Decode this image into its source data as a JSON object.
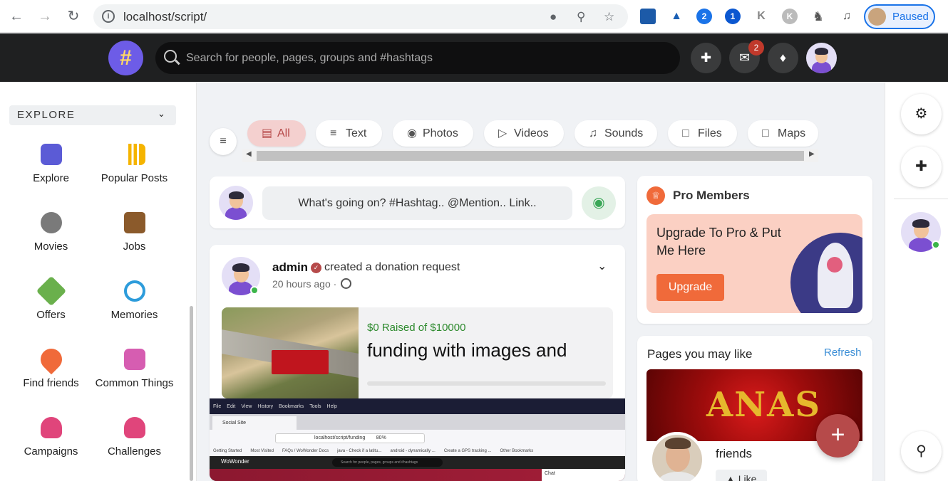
{
  "browser": {
    "url": "localhost/script/",
    "profile_status": "Paused",
    "extensions": [
      "map-ext-icon",
      "drive-ext-icon",
      "2-badge-icon",
      "1-badge-icon",
      "k-icon",
      "k-grey-icon",
      "puzzle-icon",
      "media-icon"
    ]
  },
  "header": {
    "logo": "#",
    "search_placeholder": "Search for people, pages, groups and #hashtags",
    "messages_badge": "2"
  },
  "sidebar": {
    "section": "EXPLORE",
    "items": [
      {
        "label": "Explore",
        "color": "#5b5bd6"
      },
      {
        "label": "Popular Posts",
        "color": "#f5b400"
      },
      {
        "label": "Movies",
        "color": "#7a7a7a"
      },
      {
        "label": "Jobs",
        "color": "#8b5a2b"
      },
      {
        "label": "Offers",
        "color": "#6ab04c"
      },
      {
        "label": "Memories",
        "color": "#2d9cdb"
      },
      {
        "label": "Find friends",
        "color": "#f06a3a"
      },
      {
        "label": "Common Things",
        "color": "#d65db1"
      },
      {
        "label": "Campaigns",
        "color": "#e0457b"
      },
      {
        "label": "Challenges",
        "color": "#e0457b"
      }
    ]
  },
  "filters": [
    {
      "label": "All",
      "icon": "document-icon",
      "active": true
    },
    {
      "label": "Text",
      "icon": "lines-icon",
      "active": false
    },
    {
      "label": "Photos",
      "icon": "camera-icon",
      "active": false
    },
    {
      "label": "Videos",
      "icon": "video-icon",
      "active": false
    },
    {
      "label": "Sounds",
      "icon": "music-icon",
      "active": false
    },
    {
      "label": "Files",
      "icon": "file-icon",
      "active": false
    },
    {
      "label": "Maps",
      "icon": "map-icon",
      "active": false
    }
  ],
  "publisher": {
    "placeholder": "What's going on? #Hashtag.. @Mention.. Link.."
  },
  "post": {
    "author": "admin",
    "action": "created a donation request",
    "time": "20 hours ago",
    "donation": {
      "raised": "$0 Raised of $10000",
      "title": "funding with images and videos"
    },
    "screenshot": {
      "menu": [
        "File",
        "Edit",
        "View",
        "History",
        "Bookmarks",
        "Tools",
        "Help"
      ],
      "tab_title": "Social Site",
      "address": "localhost/script/funding",
      "zoom": "80%",
      "bookmarks": [
        "Getting Started",
        "Most Visited",
        "FAQs / WoWonder Docs",
        "java - Check if a latitu...",
        "android - dynamically ...",
        "Create a GPS tracking ...",
        "Other Bookmarks"
      ],
      "brand": "WoWonder",
      "search": "Search for people, pages, groups and #hashtags",
      "chat": "Chat"
    }
  },
  "pro": {
    "title": "Pro Members",
    "promo_text": "Upgrade To Pro & Put Me Here",
    "button": "Upgrade"
  },
  "pages": {
    "title": "Pages you may like",
    "refresh": "Refresh",
    "banner_text": "ANAS",
    "page_name": "friends",
    "like": "Like"
  },
  "fab": "+"
}
